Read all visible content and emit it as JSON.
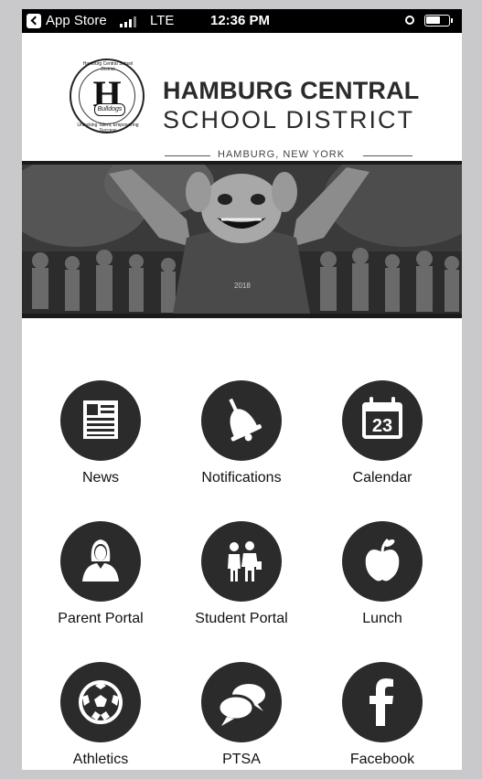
{
  "status_bar": {
    "back_app": "App Store",
    "carrier": "LTE",
    "time": "12:36 PM"
  },
  "header": {
    "title_line1": "HAMBURG CENTRAL",
    "title_line2": "SCHOOL DISTRICT",
    "subtitle": "HAMBURG, NEW YORK",
    "seal_letter": "H",
    "seal_ribbon": "Bulldogs",
    "seal_ring_top": "Hamburg Central School District",
    "seal_ring_bottom": "Unlocking Talent, Empowering Success"
  },
  "banner": {
    "shirt_text": "2018"
  },
  "menu": [
    {
      "label": "News",
      "icon": "news-icon"
    },
    {
      "label": "Notifications",
      "icon": "bell-icon"
    },
    {
      "label": "Calendar",
      "icon": "calendar-icon",
      "date": "23"
    },
    {
      "label": "Parent Portal",
      "icon": "parent-icon"
    },
    {
      "label": "Student Portal",
      "icon": "students-icon"
    },
    {
      "label": "Lunch",
      "icon": "apple-icon"
    },
    {
      "label": "Athletics",
      "icon": "soccer-ball-icon"
    },
    {
      "label": "PTSA",
      "icon": "chat-bubbles-icon"
    },
    {
      "label": "Facebook",
      "icon": "facebook-icon"
    }
  ]
}
